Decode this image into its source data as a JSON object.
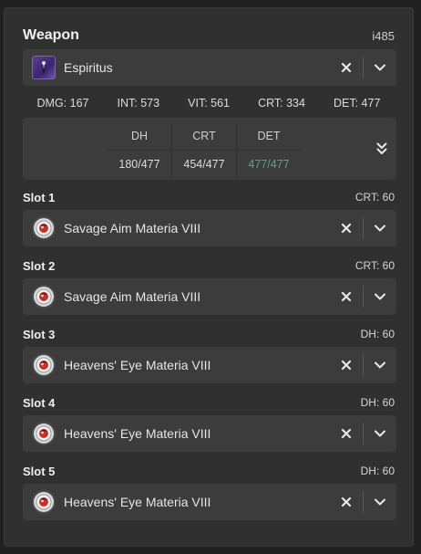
{
  "weapon": {
    "title": "Weapon",
    "ilvl": "i485",
    "name": "Espiritus",
    "icon": "staff-weapon-icon",
    "stats": [
      "DMG: 167",
      "INT: 573",
      "VIT: 561",
      "CRT: 334",
      "DET: 477"
    ],
    "substats": {
      "headers": [
        "DH",
        "CRT",
        "DET"
      ],
      "values": [
        "180/477",
        "454/477",
        "477/477"
      ],
      "highlight_color": "#4caf72"
    }
  },
  "slots": [
    {
      "name": "Slot 1",
      "stat": "CRT: 60",
      "materia": "Savage Aim Materia VIII"
    },
    {
      "name": "Slot 2",
      "stat": "CRT: 60",
      "materia": "Savage Aim Materia VIII"
    },
    {
      "name": "Slot 3",
      "stat": "DH: 60",
      "materia": "Heavens' Eye Materia VIII"
    },
    {
      "name": "Slot 4",
      "stat": "DH: 60",
      "materia": "Heavens' Eye Materia VIII"
    },
    {
      "name": "Slot 5",
      "stat": "DH: 60",
      "materia": "Heavens' Eye Materia VIII"
    }
  ],
  "colors": {
    "panel": "#303030",
    "field": "#3c3c3c",
    "text": "#e8e8e8",
    "positive": "#4caf72"
  }
}
